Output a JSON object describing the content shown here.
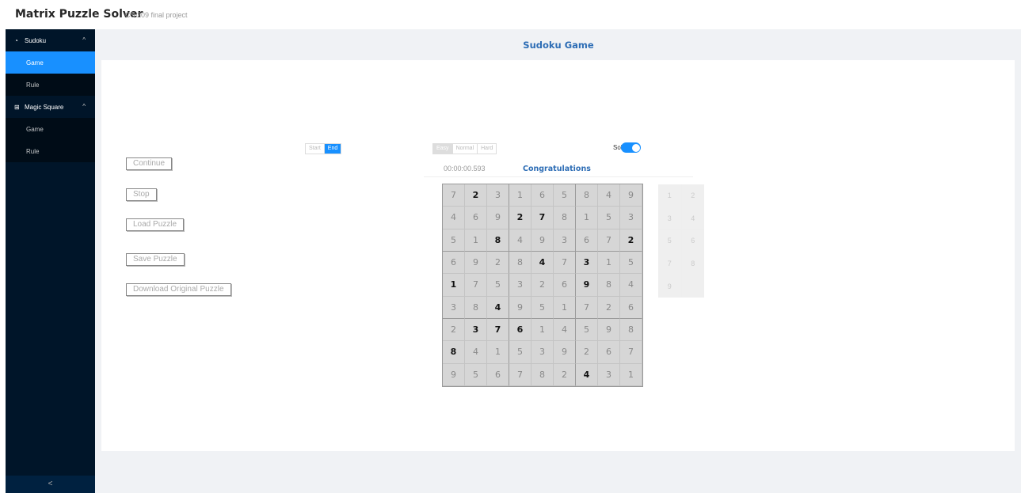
{
  "app": {
    "title": "Matrix Puzzle Solver",
    "subtitle": "CS 209 final project"
  },
  "sidebar": {
    "groups": [
      {
        "label": "Sudoku",
        "icon": "clock-icon",
        "items": [
          "Game",
          "Rule"
        ]
      },
      {
        "label": "Magic Square",
        "icon": "grid-icon",
        "items": [
          "Game",
          "Rule"
        ]
      }
    ],
    "active_item": "Sudoku / Game",
    "collapse_label": "<"
  },
  "page": {
    "title": "Sudoku Game"
  },
  "start_end": {
    "start": "Start",
    "end": "End",
    "selected": "End"
  },
  "difficulty": {
    "easy": "Easy",
    "normal": "Normal",
    "hard": "Hard",
    "selected": "Easy"
  },
  "solver": {
    "label": "Solver",
    "enabled": true
  },
  "buttons": {
    "continue": "Continue",
    "stop": "Stop",
    "load": "Load Puzzle",
    "save": "Save Puzzle",
    "download": "Download Original Puzzle"
  },
  "status": {
    "timer": "00:00:00.593",
    "message": "Congratulations"
  },
  "board": [
    [
      7,
      2,
      3,
      1,
      6,
      5,
      8,
      4,
      9
    ],
    [
      4,
      6,
      9,
      2,
      7,
      8,
      1,
      5,
      3
    ],
    [
      5,
      1,
      8,
      4,
      9,
      3,
      6,
      7,
      2
    ],
    [
      6,
      9,
      2,
      8,
      4,
      7,
      3,
      1,
      5
    ],
    [
      1,
      7,
      5,
      3,
      2,
      6,
      9,
      8,
      4
    ],
    [
      3,
      8,
      4,
      9,
      5,
      1,
      7,
      2,
      6
    ],
    [
      2,
      3,
      7,
      6,
      1,
      4,
      5,
      9,
      8
    ],
    [
      8,
      4,
      1,
      5,
      3,
      9,
      2,
      6,
      7
    ],
    [
      9,
      5,
      6,
      7,
      8,
      2,
      4,
      3,
      1
    ]
  ],
  "givens": [
    [
      0,
      1,
      0,
      0,
      0,
      0,
      0,
      0,
      0
    ],
    [
      0,
      0,
      0,
      1,
      1,
      0,
      0,
      0,
      0
    ],
    [
      0,
      0,
      1,
      0,
      0,
      0,
      0,
      0,
      1
    ],
    [
      0,
      0,
      0,
      0,
      1,
      0,
      1,
      0,
      0
    ],
    [
      1,
      0,
      0,
      0,
      0,
      0,
      1,
      0,
      0
    ],
    [
      0,
      0,
      1,
      0,
      0,
      0,
      0,
      0,
      0
    ],
    [
      0,
      1,
      1,
      1,
      0,
      0,
      0,
      0,
      0
    ],
    [
      1,
      0,
      0,
      0,
      0,
      0,
      0,
      0,
      0
    ],
    [
      0,
      0,
      0,
      0,
      0,
      0,
      1,
      0,
      0
    ]
  ],
  "number_pad": [
    "1",
    "2",
    "3",
    "4",
    "5",
    "6",
    "7",
    "8",
    "9",
    ""
  ]
}
